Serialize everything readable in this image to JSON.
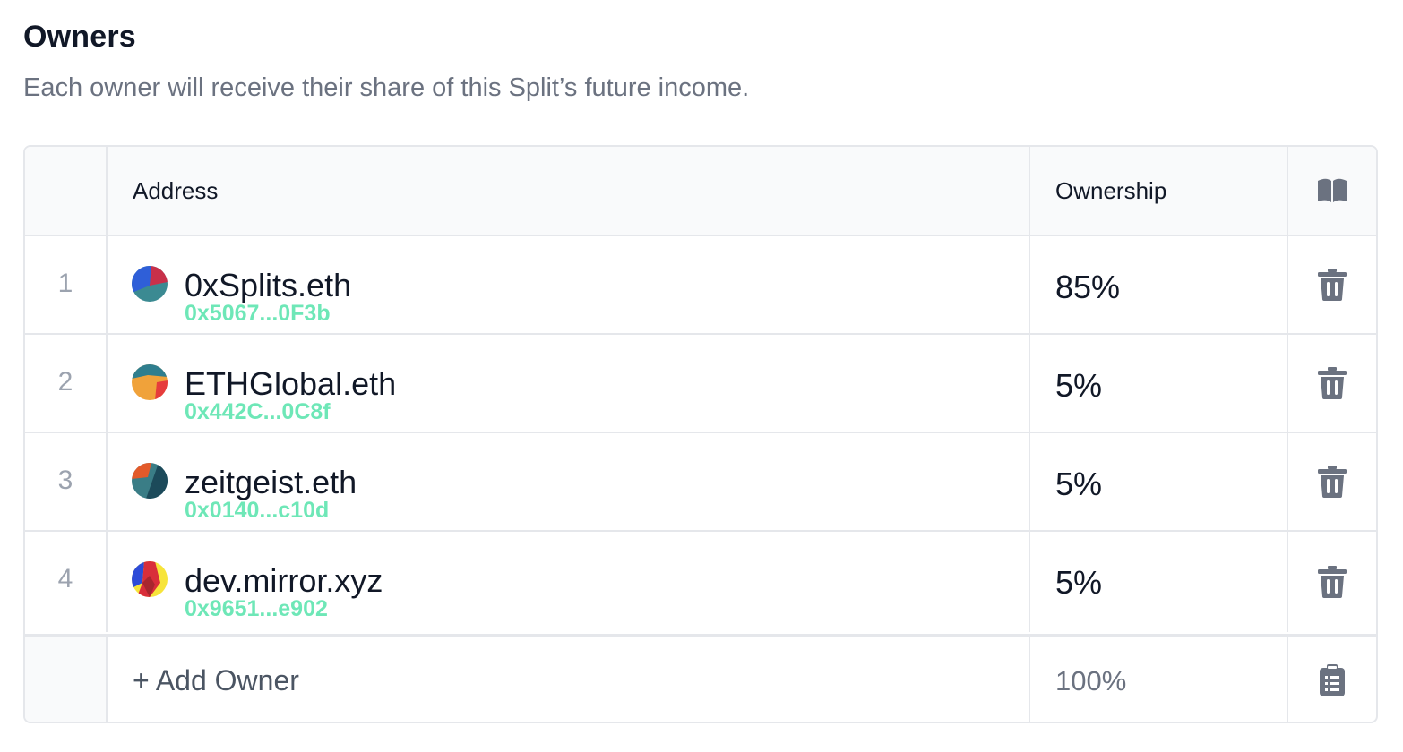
{
  "header": {
    "title": "Owners",
    "subtitle": "Each owner will receive their share of this Split’s future income."
  },
  "table": {
    "columns": {
      "address": "Address",
      "ownership": "Ownership",
      "action_icon": "book-open-icon"
    },
    "rows": [
      {
        "index": "1",
        "ens": "0xSplits.eth",
        "address": "0x5067...0F3b",
        "ownership": "85%",
        "avatar_colors": [
          "#2f5fd8",
          "#c8304a",
          "#3b8a92"
        ],
        "action_icon": "trash-icon"
      },
      {
        "index": "2",
        "ens": "ETHGlobal.eth",
        "address": "0x442C...0C8f",
        "ownership": "5%",
        "avatar_colors": [
          "#f0a23a",
          "#2f7e8e",
          "#e63c3c"
        ],
        "action_icon": "trash-icon"
      },
      {
        "index": "3",
        "ens": "zeitgeist.eth",
        "address": "0x0140...c10d",
        "ownership": "5%",
        "avatar_colors": [
          "#3a7d86",
          "#e35a2a",
          "#1c4a5a"
        ],
        "action_icon": "trash-icon"
      },
      {
        "index": "4",
        "ens": "dev.mirror.xyz",
        "address": "0x9651...e902",
        "ownership": "5%",
        "avatar_colors": [
          "#2d4bd8",
          "#d92e3a",
          "#f7e43a"
        ],
        "action_icon": "trash-icon"
      }
    ],
    "footer": {
      "add_label": "+ Add Owner",
      "total": "100%",
      "action_icon": "clipboard-list-icon"
    }
  },
  "colors": {
    "address_green": "#6ee7b7",
    "icon_gray": "#6b7280",
    "border": "#e5e7eb",
    "header_bg": "#f9fafb"
  }
}
